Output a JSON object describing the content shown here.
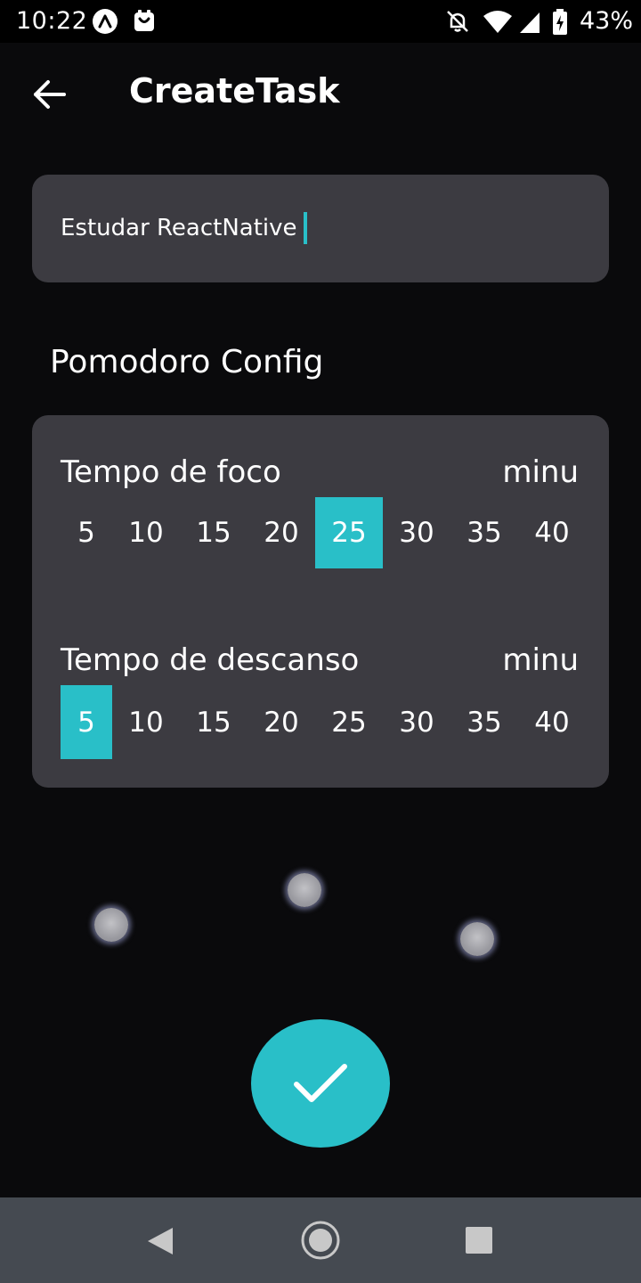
{
  "status_bar": {
    "time": "10:22",
    "battery_percent": "43%",
    "icons": [
      "app-a-icon",
      "app-shield-icon",
      "bell-off-icon",
      "wifi-icon",
      "signal-icon",
      "battery-icon"
    ]
  },
  "header": {
    "title": "CreateTask",
    "back_icon": "arrow-left-icon"
  },
  "task_name": {
    "value": "Estudar ReactNative"
  },
  "section_title": "Pomodoro Config",
  "focus": {
    "label": "Tempo de foco",
    "unit": "minu",
    "options": [
      "5",
      "10",
      "15",
      "20",
      "25",
      "30",
      "35",
      "40"
    ],
    "selected": "25"
  },
  "rest": {
    "label": "Tempo de descanso",
    "unit": "minu",
    "options": [
      "5",
      "10",
      "15",
      "20",
      "25",
      "30",
      "35",
      "40"
    ],
    "selected": "5"
  },
  "confirm_icon": "check-icon",
  "colors": {
    "accent": "#29bfc8",
    "card": "#3c3b41",
    "background": "#0a0a0c",
    "nav_bar": "#454a51"
  },
  "nav_bar": {
    "icons": [
      "nav-back-icon",
      "nav-home-icon",
      "nav-recents-icon"
    ]
  }
}
